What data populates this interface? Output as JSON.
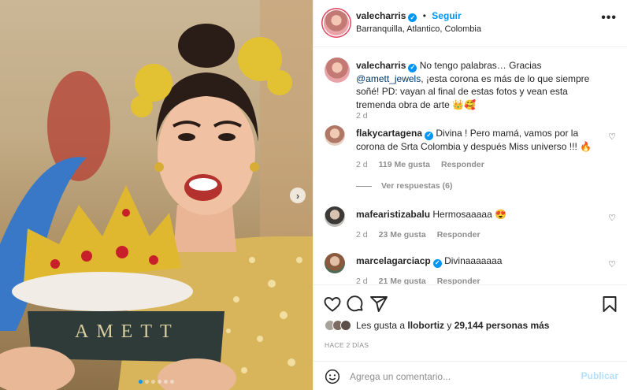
{
  "post": {
    "username": "valecharris",
    "follow_label": "Seguir",
    "location": "Barranquilla, Atlantico, Colombia",
    "more_icon": "ellipsis-icon"
  },
  "caption": {
    "username": "valecharris",
    "text_before": " No tengo palabras… Gracias ",
    "mention": "@amett_jewels",
    "text_after": ", ¡esta corona es más de lo que siempre soñé! PD: vayan al final de estas fotos y vean esta tremenda obra de arte 👑🥰",
    "age": "2 d"
  },
  "comments": [
    {
      "username": "flakycartagena",
      "verified": true,
      "text": " Divina ! Pero mamá, vamos por la corona de Srta Colombia y después Miss universo !!! 🔥",
      "age": "2 d",
      "likes": "119 Me gusta",
      "reply": "Responder"
    },
    {
      "username": "mafearistizabalu",
      "verified": false,
      "text": " Hermosaaaaa 😍",
      "age": "2 d",
      "likes": "23 Me gusta",
      "reply": "Responder"
    },
    {
      "username": "marcelagarciacp",
      "verified": true,
      "text": " Divinaaaaaaa",
      "age": "2 d",
      "likes": "21 Me gusta",
      "reply": "Responder"
    }
  ],
  "view_replies": "Ver respuestas (6)",
  "likes": {
    "prefix": "Les gusta a ",
    "user": "llobortiz",
    "middle": " y ",
    "count": "29,144 personas más"
  },
  "timestamp": "HACE 2 DÍAS",
  "comment_input": {
    "placeholder": "Agrega un comentario...",
    "publish": "Publicar"
  },
  "photo": {
    "plaque_text": "AMETT",
    "carousel": {
      "dot_count": 6,
      "active_dot": 0
    }
  },
  "colors": {
    "accent": "#0095f6",
    "muted": "#8e8e8e",
    "text": "#262626",
    "publish_disabled": "#b2dffc"
  }
}
